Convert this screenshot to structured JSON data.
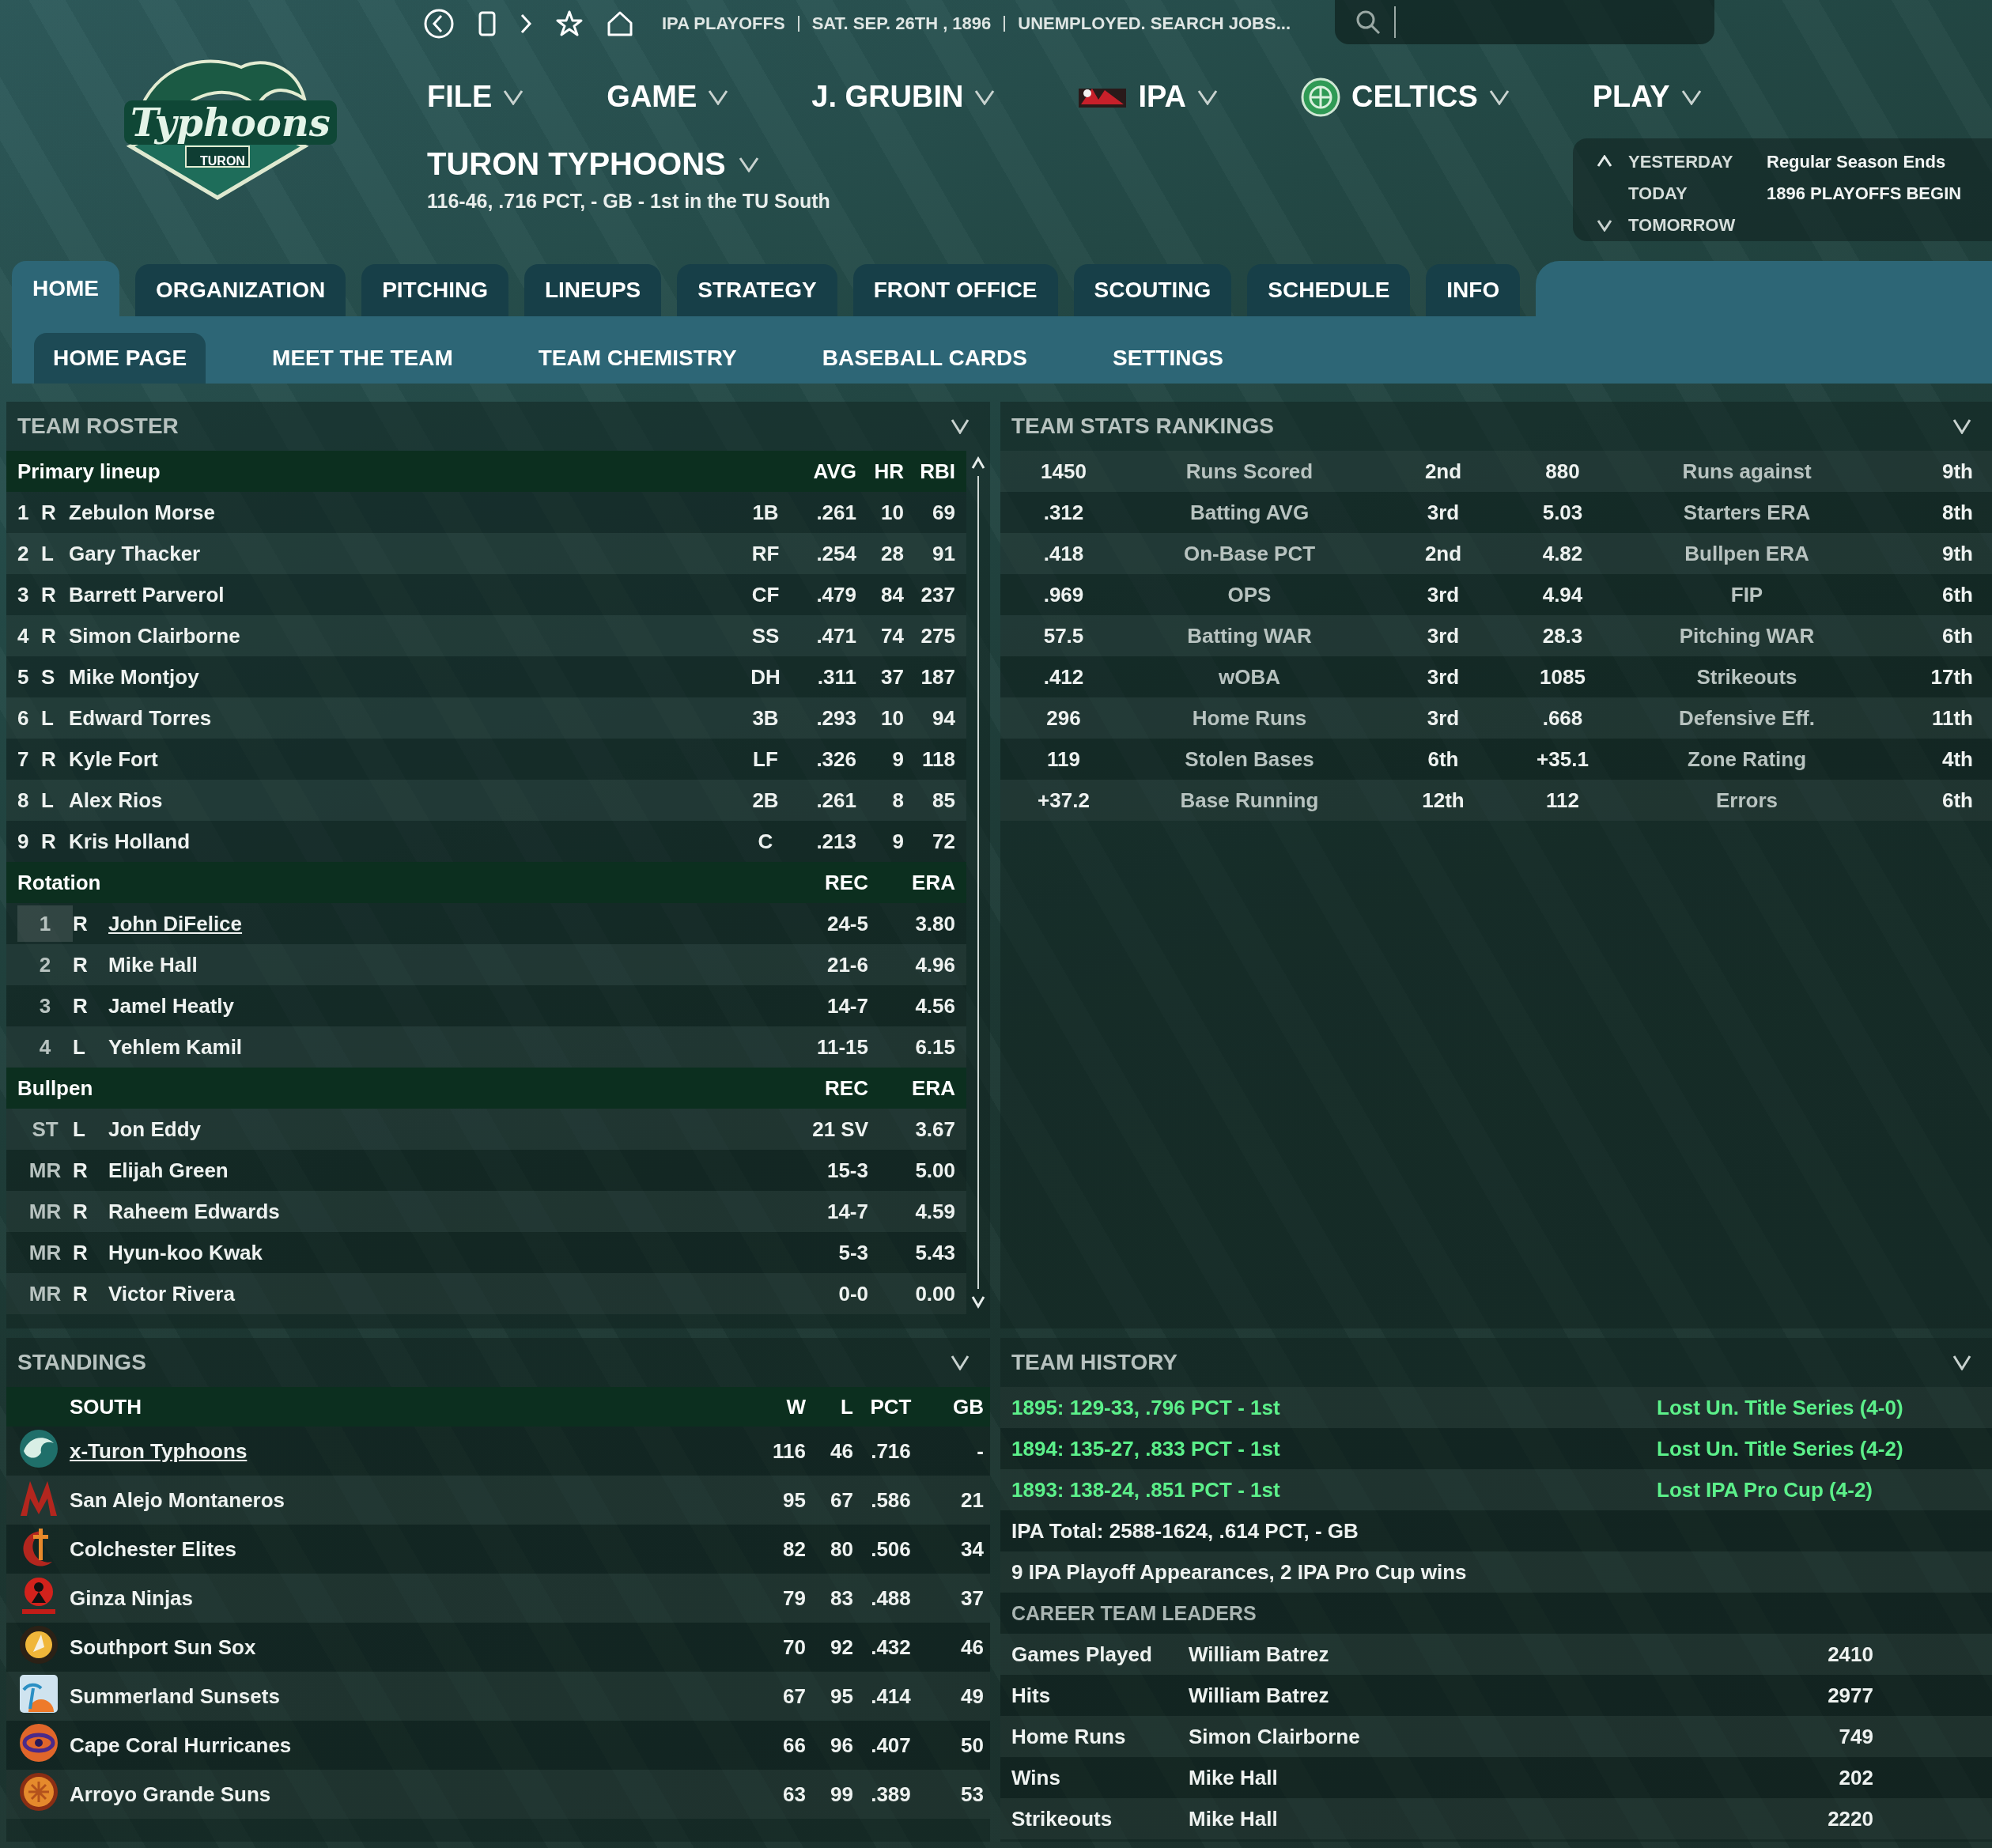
{
  "logo": {
    "wordmark": "Typhoons",
    "subtitle": "TURON"
  },
  "breadcrumb": [
    "IPA PLAYOFFS",
    "SAT. SEP. 26TH , 1896",
    "UNEMPLOYED. SEARCH JOBS..."
  ],
  "main_menu": [
    {
      "label": "FILE",
      "kind": "plain"
    },
    {
      "label": "GAME",
      "kind": "plain"
    },
    {
      "label": "J. GRUBIN",
      "kind": "plain"
    },
    {
      "label": "IPA",
      "kind": "league"
    },
    {
      "label": "CELTICS",
      "kind": "club"
    },
    {
      "label": "PLAY",
      "kind": "plain"
    }
  ],
  "team": {
    "name": "TURON TYPHOONS",
    "summary": "116-46, .716 PCT, - GB - 1st in the TU South"
  },
  "calendar": [
    {
      "label": "YESTERDAY",
      "event": "Regular Season Ends",
      "kind": "previous"
    },
    {
      "label": "TODAY",
      "event": "1896 PLAYOFFS BEGIN",
      "kind": "current"
    },
    {
      "label": "TOMORROW",
      "kind": "next"
    }
  ],
  "tabs": [
    {
      "label": "HOME",
      "selected": true
    },
    {
      "label": "ORGANIZATION",
      "selected": false
    },
    {
      "label": "PITCHING",
      "selected": false
    },
    {
      "label": "LINEUPS",
      "selected": false
    },
    {
      "label": "STRATEGY",
      "selected": false
    },
    {
      "label": "FRONT OFFICE",
      "selected": false
    },
    {
      "label": "SCOUTING",
      "selected": false
    },
    {
      "label": "SCHEDULE",
      "selected": false
    },
    {
      "label": "INFO",
      "selected": false
    }
  ],
  "subtabs": [
    {
      "label": "HOME PAGE",
      "selected": true
    },
    {
      "label": "MEET THE TEAM",
      "selected": false
    },
    {
      "label": "TEAM CHEMISTRY",
      "selected": false
    },
    {
      "label": "BASEBALL CARDS",
      "selected": false
    },
    {
      "label": "SETTINGS",
      "selected": false
    }
  ],
  "roster": {
    "title": "TEAM ROSTER",
    "sections": [
      {
        "kind": "lineup",
        "title": "Primary lineup",
        "columns": [
          "AVG",
          "HR",
          "RBI"
        ],
        "rows": [
          {
            "lead": "1",
            "hand": "R",
            "name": "Zebulon Morse",
            "pos": "1B",
            "stats": [
              ".261",
              "10",
              "69"
            ],
            "selected": false
          },
          {
            "lead": "2",
            "hand": "L",
            "name": "Gary Thacker",
            "pos": "RF",
            "stats": [
              ".254",
              "28",
              "91"
            ],
            "selected": false
          },
          {
            "lead": "3",
            "hand": "R",
            "name": "Barrett Parverol",
            "pos": "CF",
            "stats": [
              ".479",
              "84",
              "237"
            ],
            "selected": false
          },
          {
            "lead": "4",
            "hand": "R",
            "name": "Simon Clairborne",
            "pos": "SS",
            "stats": [
              ".471",
              "74",
              "275"
            ],
            "selected": false
          },
          {
            "lead": "5",
            "hand": "S",
            "name": "Mike Montjoy",
            "pos": "DH",
            "stats": [
              ".311",
              "37",
              "187"
            ],
            "selected": false
          },
          {
            "lead": "6",
            "hand": "L",
            "name": "Edward Torres",
            "pos": "3B",
            "stats": [
              ".293",
              "10",
              "94"
            ],
            "selected": false
          },
          {
            "lead": "7",
            "hand": "R",
            "name": "Kyle Fort",
            "pos": "LF",
            "stats": [
              ".326",
              "9",
              "118"
            ],
            "selected": false
          },
          {
            "lead": "8",
            "hand": "L",
            "name": "Alex Rios",
            "pos": "2B",
            "stats": [
              ".261",
              "8",
              "85"
            ],
            "selected": false
          },
          {
            "lead": "9",
            "hand": "R",
            "name": "Kris Holland",
            "pos": "C",
            "stats": [
              ".213",
              "9",
              "72"
            ],
            "selected": false
          }
        ]
      },
      {
        "kind": "pitching",
        "title": "Rotation",
        "columns": [
          "REC",
          "ERA"
        ],
        "rows": [
          {
            "lead": "1",
            "hand": "R",
            "name": "John DiFelice",
            "stats": [
              "24-5",
              "3.80"
            ],
            "selected": true
          },
          {
            "lead": "2",
            "hand": "R",
            "name": "Mike Hall",
            "stats": [
              "21-6",
              "4.96"
            ],
            "selected": false
          },
          {
            "lead": "3",
            "hand": "R",
            "name": "Jamel Heatly",
            "stats": [
              "14-7",
              "4.56"
            ],
            "selected": false
          },
          {
            "lead": "4",
            "hand": "L",
            "name": "Yehlem Kamil",
            "stats": [
              "11-15",
              "6.15"
            ],
            "selected": false
          }
        ]
      },
      {
        "kind": "pitching",
        "title": "Bullpen",
        "columns": [
          "REC",
          "ERA"
        ],
        "rows": [
          {
            "lead": "ST",
            "hand": "L",
            "name": "Jon Eddy",
            "stats": [
              "21 SV",
              "3.67"
            ],
            "selected": false
          },
          {
            "lead": "MR",
            "hand": "R",
            "name": "Elijah Green",
            "stats": [
              "15-3",
              "5.00"
            ],
            "selected": false
          },
          {
            "lead": "MR",
            "hand": "R",
            "name": "Raheem Edwards",
            "stats": [
              "14-7",
              "4.59"
            ],
            "selected": false
          },
          {
            "lead": "MR",
            "hand": "R",
            "name": "Hyun-koo Kwak",
            "stats": [
              "5-3",
              "5.43"
            ],
            "selected": false
          },
          {
            "lead": "MR",
            "hand": "R",
            "name": "Victor Rivera",
            "stats": [
              "0-0",
              "0.00"
            ],
            "selected": false
          }
        ]
      }
    ]
  },
  "rankings": {
    "title": "TEAM STATS RANKINGS",
    "rows": [
      [
        "1450",
        "Runs Scored",
        "2nd",
        "880",
        "Runs against",
        "9th"
      ],
      [
        ".312",
        "Batting AVG",
        "3rd",
        "5.03",
        "Starters ERA",
        "8th"
      ],
      [
        ".418",
        "On-Base PCT",
        "2nd",
        "4.82",
        "Bullpen ERA",
        "9th"
      ],
      [
        ".969",
        "OPS",
        "3rd",
        "4.94",
        "FIP",
        "6th"
      ],
      [
        "57.5",
        "Batting WAR",
        "3rd",
        "28.3",
        "Pitching WAR",
        "6th"
      ],
      [
        ".412",
        "wOBA",
        "3rd",
        "1085",
        "Strikeouts",
        "17th"
      ],
      [
        "296",
        "Home Runs",
        "3rd",
        ".668",
        "Defensive Eff.",
        "11th"
      ],
      [
        "119",
        "Stolen Bases",
        "6th",
        "+35.1",
        "Zone Rating",
        "4th"
      ],
      [
        "+37.2",
        "Base Running",
        "12th",
        "112",
        "Errors",
        "6th"
      ]
    ]
  },
  "standings": {
    "title": "STANDINGS",
    "division": "SOUTH",
    "columns": [
      "W",
      "L",
      "PCT",
      "GB"
    ],
    "teams": [
      {
        "kind": "wave",
        "name": "x-Turon Typhoons",
        "w": "116",
        "l": "46",
        "pct": ".716",
        "gb": "-",
        "selected": true
      },
      {
        "kind": "peaks",
        "name": "San Alejo Montaneros",
        "w": "95",
        "l": "67",
        "pct": ".586",
        "gb": "21",
        "selected": false
      },
      {
        "kind": "sword",
        "name": "Colchester Elites",
        "w": "82",
        "l": "80",
        "pct": ".506",
        "gb": "34",
        "selected": false
      },
      {
        "kind": "figure",
        "name": "Ginza Ninjas",
        "w": "79",
        "l": "83",
        "pct": ".488",
        "gb": "37",
        "selected": false
      },
      {
        "kind": "ball",
        "name": "Southport Sun Sox",
        "w": "70",
        "l": "92",
        "pct": ".432",
        "gb": "46",
        "selected": false
      },
      {
        "kind": "palm",
        "name": "Summerland Sunsets",
        "w": "67",
        "l": "95",
        "pct": ".414",
        "gb": "49",
        "selected": false
      },
      {
        "kind": "swirl",
        "name": "Cape Coral Hurricanes",
        "w": "66",
        "l": "96",
        "pct": ".407",
        "gb": "50",
        "selected": false
      },
      {
        "kind": "sun",
        "name": "Arroyo Grande Suns",
        "w": "63",
        "l": "99",
        "pct": ".389",
        "gb": "53",
        "selected": false
      }
    ]
  },
  "history": {
    "title": "TEAM HISTORY",
    "seasons": [
      {
        "record": "1895: 129-33, .796 PCT - 1st",
        "result": "Lost Un. Title Series (4-0)"
      },
      {
        "record": "1894: 135-27, .833 PCT - 1st",
        "result": "Lost Un. Title Series (4-2)"
      },
      {
        "record": "1893: 138-24, .851 PCT - 1st",
        "result": "Lost IPA Pro Cup (4-2)"
      }
    ],
    "totals": [
      "IPA Total: 2588-1624, .614 PCT, - GB",
      "9 IPA Playoff Appearances, 2 IPA Pro Cup wins"
    ],
    "leaders_title": "CAREER TEAM LEADERS",
    "leaders": [
      {
        "category": "Games Played",
        "player": "William Batrez",
        "value": "2410"
      },
      {
        "category": "Hits",
        "player": "William Batrez",
        "value": "2977"
      },
      {
        "category": "Home Runs",
        "player": "Simon Clairborne",
        "value": "749"
      },
      {
        "category": "Wins",
        "player": "Mike Hall",
        "value": "202"
      },
      {
        "category": "Strikeouts",
        "player": "Mike Hall",
        "value": "2220"
      }
    ]
  }
}
